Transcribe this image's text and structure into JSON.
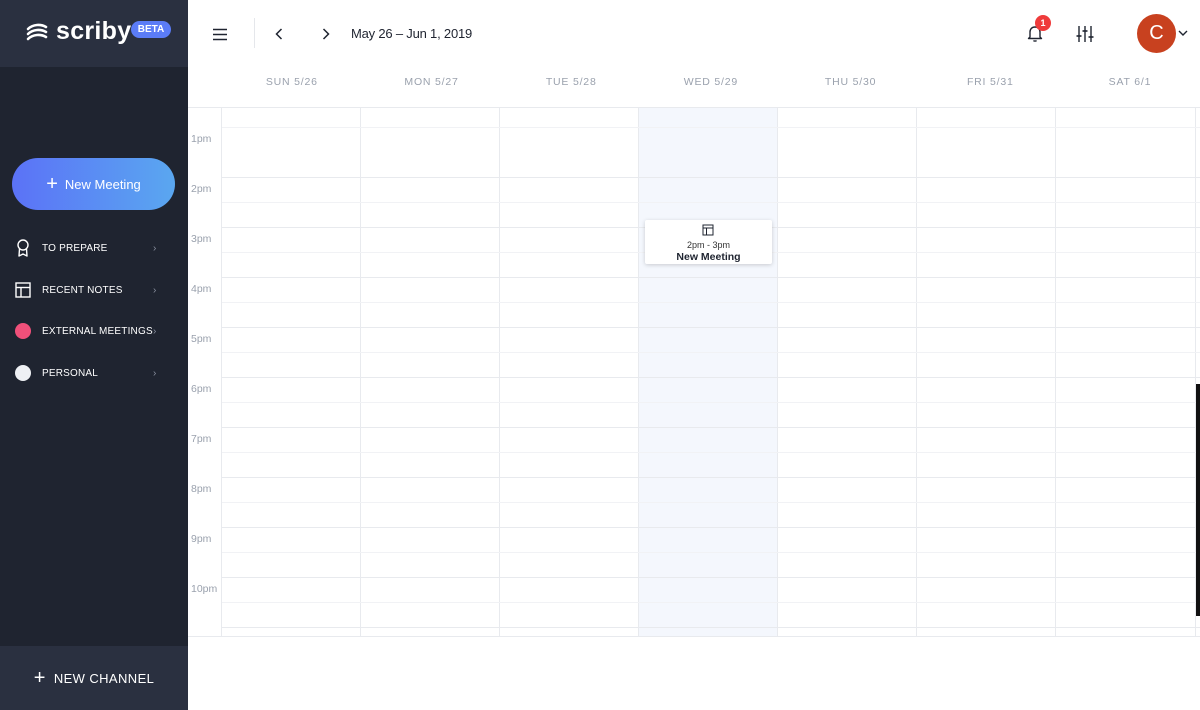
{
  "brand": {
    "name": "scriby",
    "badge": "BETA"
  },
  "sidebar": {
    "new_meeting_label": "New Meeting",
    "items": [
      {
        "label": "TO PREPARE",
        "icon": "ribbon-icon"
      },
      {
        "label": "RECENT NOTES",
        "icon": "layout-icon"
      },
      {
        "label": "EXTERNAL MEETINGS",
        "icon": "dot",
        "color": "#f0507a"
      },
      {
        "label": "PERSONAL",
        "icon": "dot",
        "color": "#eef0f4"
      }
    ],
    "footer_label": "NEW CHANNEL"
  },
  "topbar": {
    "date_range": "May 26 – Jun 1, 2019",
    "notification_count": "1",
    "avatar_initial": "C"
  },
  "calendar": {
    "days": [
      "SUN 5/26",
      "MON 5/27",
      "TUE 5/28",
      "WED 5/29",
      "THU 5/30",
      "FRI 5/31",
      "SAT 6/1"
    ],
    "today_index": 3,
    "hours": [
      "1pm",
      "2pm",
      "3pm",
      "4pm",
      "5pm",
      "6pm",
      "7pm",
      "8pm",
      "9pm",
      "10pm"
    ],
    "events": [
      {
        "day": "WED 5/29",
        "time": "2pm - 3pm",
        "title": "New Meeting"
      }
    ]
  }
}
